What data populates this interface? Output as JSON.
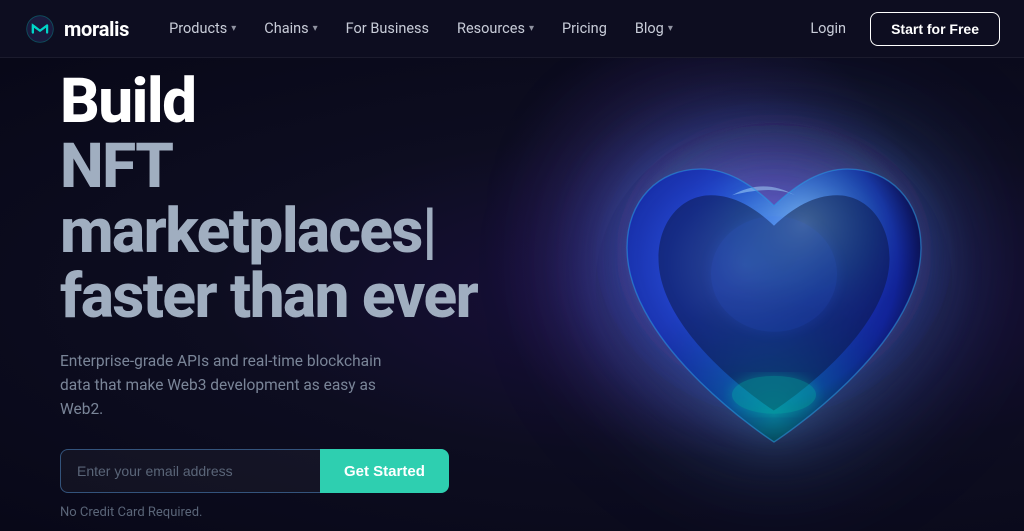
{
  "navbar": {
    "logo_text": "moralis",
    "nav_items": [
      {
        "label": "Products",
        "has_dropdown": true
      },
      {
        "label": "Chains",
        "has_dropdown": true
      },
      {
        "label": "For Business",
        "has_dropdown": false
      },
      {
        "label": "Resources",
        "has_dropdown": true
      },
      {
        "label": "Pricing",
        "has_dropdown": false
      },
      {
        "label": "Blog",
        "has_dropdown": true
      }
    ],
    "login_label": "Login",
    "start_label": "Start for Free"
  },
  "hero": {
    "title_line1": "Build",
    "title_line2": "NFT marketplaces|",
    "title_line3": "faster than ever",
    "subtitle": "Enterprise-grade APIs and real-time blockchain data that make Web3 development as easy as Web2.",
    "email_placeholder": "Enter your email address",
    "cta_label": "Get Started",
    "no_credit_label": "No Credit Card Required."
  }
}
